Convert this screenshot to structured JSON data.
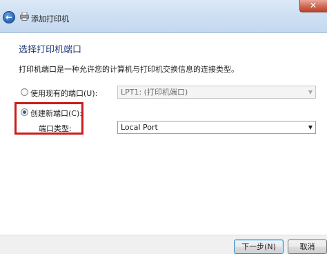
{
  "window": {
    "title": "添加打印机",
    "back_icon": "back-arrow-icon",
    "close_icon": "close-icon",
    "close_label": "✕"
  },
  "main": {
    "page_title": "选择打印机端口",
    "description": "打印机端口是一种允许您的计算机与打印机交换信息的连接类型。",
    "option_existing": {
      "label": "使用现有的端口(U):",
      "selected": false,
      "value": "LPT1: (打印机端口)"
    },
    "option_new": {
      "label": "创建新端口(C):",
      "selected": true,
      "type_label": "端口类型:",
      "value": "Local Port"
    }
  },
  "footer": {
    "next_label": "下一步(N)",
    "cancel_label": "取消"
  },
  "colors": {
    "title_color": "#1e3a78",
    "highlight": "#cc1b1b"
  }
}
